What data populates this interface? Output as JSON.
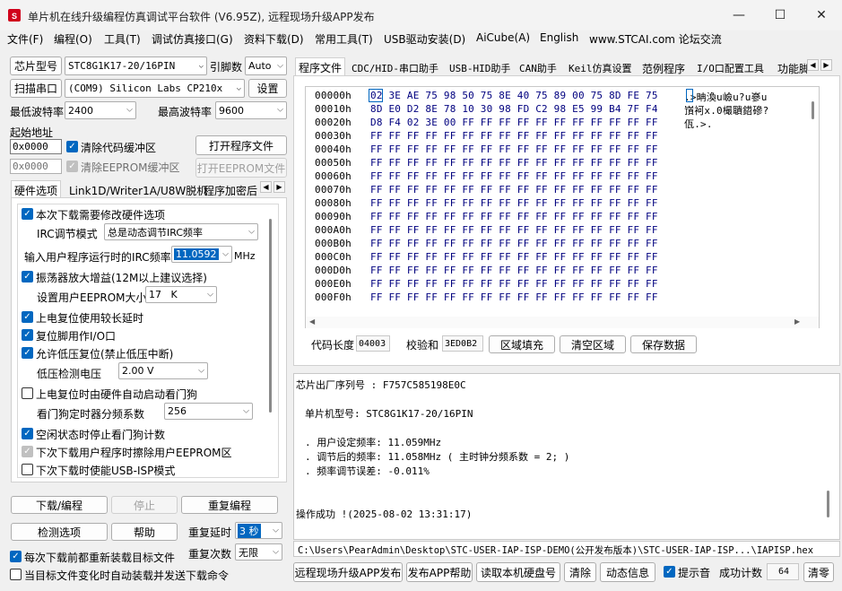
{
  "window": {
    "title": "单片机在线升级编程仿真调试平台软件 (V6.95Z), 远程现场升级APP发布",
    "min_icon": "—",
    "max_icon": "☐",
    "close_icon": "✕"
  },
  "menu": [
    "文件(F)",
    "编程(O)",
    "工具(T)",
    "调试仿真接口(G)",
    "资料下载(D)",
    "常用工具(T)",
    "USB驱动安装(D)",
    "AiCube(A)",
    "English",
    "www.STCAI.com 论坛交流"
  ],
  "left": {
    "chip_model_btn": "芯片型号",
    "chip_model_value": "STC8G1K17-20/16PIN",
    "pin_label": "引脚数",
    "pin_value": "Auto",
    "scan_port_btn": "扫描串口",
    "port_value": "(COM9) Silicon Labs CP210x USB to UART",
    "settings_btn": "设置",
    "min_baud_label": "最低波特率",
    "min_baud_value": "2400",
    "max_baud_label": "最高波特率",
    "max_baud_value": "9600",
    "start_addr_label": "起始地址",
    "code_addr_value": "0x0000",
    "clear_code_label": "清除代码缓冲区",
    "open_prog_btn": "打开程序文件",
    "eeprom_addr_value": "0x0000",
    "clear_eeprom_label": "清除EEPROM缓冲区",
    "open_eeprom_btn": "打开EEPROM文件",
    "tabs": [
      "硬件选项",
      "Link1D/Writer1A/U8W脱机",
      "程序加密后"
    ],
    "hw": {
      "modify_hw": "本次下载需要修改硬件选项",
      "irc_mode_label": "IRC调节模式",
      "irc_mode_value": "总是动态调节IRC频率",
      "irc_freq_label": "输入用户程序运行时的IRC频率",
      "irc_freq_value": "11.0592",
      "irc_freq_unit": "MHz",
      "osc_gain": "振荡器放大增益(12M以上建议选择)",
      "eeprom_size_label": "设置用户EEPROM大小",
      "eeprom_size_value": "17   K",
      "por_delay": "上电复位使用较长延时",
      "reset_io": "复位脚用作I/O口",
      "lvr": "允许低压复位(禁止低压中断)",
      "lvd_label": "低压检测电压",
      "lvd_value": "2.00 V",
      "wdt_auto": "上电复位时由硬件自动启动看门狗",
      "wdt_div_label": "看门狗定时器分频系数",
      "wdt_div_value": "256",
      "wdt_idle": "空闲状态时停止看门狗计数",
      "erase_eeprom": "下次下载用户程序时擦除用户EEPROM区",
      "usb_isp": "下次下载时使能USB-ISP模式"
    },
    "download_btn": "下载/编程",
    "stop_btn": "停止",
    "reprog_btn": "重复编程",
    "check_btn": "检测选项",
    "help_btn": "帮助",
    "repeat_delay_label": "重复延时",
    "repeat_delay_value": "3 秒",
    "repeat_count_label": "重复次数",
    "repeat_count_value": "无限",
    "reload_label": "每次下载前都重新装载目标文件",
    "auto_send_label": "当目标文件变化时自动装载并发送下载命令"
  },
  "right": {
    "tabs": [
      "程序文件",
      "CDC/HID-串口助手",
      "USB-HID助手",
      "CAN助手",
      "Keil仿真设置",
      "范例程序",
      "I/O口配置工具",
      "功能脚"
    ],
    "hex_rows": [
      {
        "addr": "00000h",
        "bytes": "02 3E AE 75 98 50 75 8E 40 75 89 00 75 8D FE 75",
        "ascii": ".>畘渙u嶮u?u嵾u"
      },
      {
        "addr": "00010h",
        "bytes": "8D E0 D2 8E 78 10 30 98 FD C2 98 E5 99 B4 7F F4",
        "ascii": "嵿袔x.0樶聵鍣磣?"
      },
      {
        "addr": "00020h",
        "bytes": "D8 F4 02 3E 00 FF FF FF FF FF FF FF FF FF FF FF",
        "ascii": "佤.>."
      },
      {
        "addr": "00030h",
        "bytes": "FF FF FF FF FF FF FF FF FF FF FF FF FF FF FF FF",
        "ascii": ""
      },
      {
        "addr": "00040h",
        "bytes": "FF FF FF FF FF FF FF FF FF FF FF FF FF FF FF FF",
        "ascii": ""
      },
      {
        "addr": "00050h",
        "bytes": "FF FF FF FF FF FF FF FF FF FF FF FF FF FF FF FF",
        "ascii": ""
      },
      {
        "addr": "00060h",
        "bytes": "FF FF FF FF FF FF FF FF FF FF FF FF FF FF FF FF",
        "ascii": ""
      },
      {
        "addr": "00070h",
        "bytes": "FF FF FF FF FF FF FF FF FF FF FF FF FF FF FF FF",
        "ascii": ""
      },
      {
        "addr": "00080h",
        "bytes": "FF FF FF FF FF FF FF FF FF FF FF FF FF FF FF FF",
        "ascii": ""
      },
      {
        "addr": "00090h",
        "bytes": "FF FF FF FF FF FF FF FF FF FF FF FF FF FF FF FF",
        "ascii": ""
      },
      {
        "addr": "000A0h",
        "bytes": "FF FF FF FF FF FF FF FF FF FF FF FF FF FF FF FF",
        "ascii": ""
      },
      {
        "addr": "000B0h",
        "bytes": "FF FF FF FF FF FF FF FF FF FF FF FF FF FF FF FF",
        "ascii": ""
      },
      {
        "addr": "000C0h",
        "bytes": "FF FF FF FF FF FF FF FF FF FF FF FF FF FF FF FF",
        "ascii": ""
      },
      {
        "addr": "000D0h",
        "bytes": "FF FF FF FF FF FF FF FF FF FF FF FF FF FF FF FF",
        "ascii": ""
      },
      {
        "addr": "000E0h",
        "bytes": "FF FF FF FF FF FF FF FF FF FF FF FF FF FF FF FF",
        "ascii": ""
      },
      {
        "addr": "000F0h",
        "bytes": "FF FF FF FF FF FF FF FF FF FF FF FF FF FF FF FF",
        "ascii": ""
      }
    ],
    "code_len_label": "代码长度",
    "code_len_value": "04003",
    "checksum_label": "校验和",
    "checksum_value": "3ED0B2",
    "fill_btn": "区域填充",
    "clear_btn": "清空区域",
    "save_btn": "保存数据",
    "log": [
      "芯片出厂序列号 : F757C585198E0C",
      "",
      "单片机型号: STC8G1K17-20/16PIN",
      "",
      ". 用户设定频率: 11.059MHz",
      ". 调节后的频率: 11.058MHz ( 主时钟分频系数 = 2; )",
      ". 频率调节误差: -0.011%",
      "",
      "",
      "操作成功 !(2025-08-02 13:31:17)"
    ],
    "path": "C:\\Users\\PearAdmin\\Desktop\\STC-USER-IAP-ISP-DEMO(公开发布版本)\\STC-USER-IAP-ISP...\\IAPISP.hex",
    "remote_btn": "远程现场升级APP发布",
    "publish_help_btn": "发布APP帮助",
    "read_disk_btn": "读取本机硬盘号",
    "clear_log_btn": "清除",
    "dyn_info_btn": "动态信息",
    "beep_label": "提示音",
    "success_label": "成功计数",
    "success_value": "64",
    "zero_btn": "清零"
  }
}
